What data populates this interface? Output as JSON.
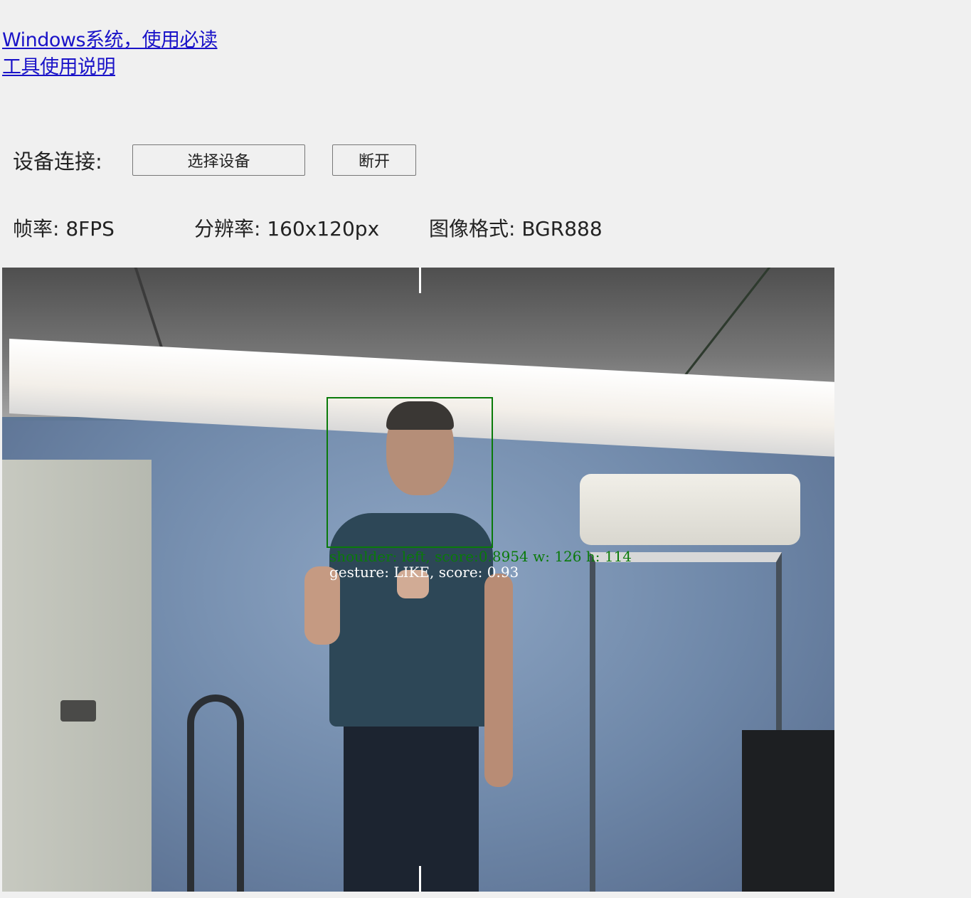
{
  "links": [
    {
      "label": "Windows系统，使用必读"
    },
    {
      "label": "工具使用说明"
    }
  ],
  "connection": {
    "label": "设备连接:",
    "select_button": "选择设备",
    "disconnect_button": "断开"
  },
  "info": {
    "fps": "帧率: 8FPS",
    "resolution": "分辨率: 160x120px",
    "format": "图像格式: BGR888"
  },
  "video": {
    "detection_line": "shoulder: left, score:0.8954 w: 126 h: 114",
    "gesture_line": "gesture: LIKE, score: 0.93"
  },
  "colors": {
    "link": "#1a13c8",
    "bbox": "#0a7a0a",
    "background": "#f0f0f0"
  }
}
